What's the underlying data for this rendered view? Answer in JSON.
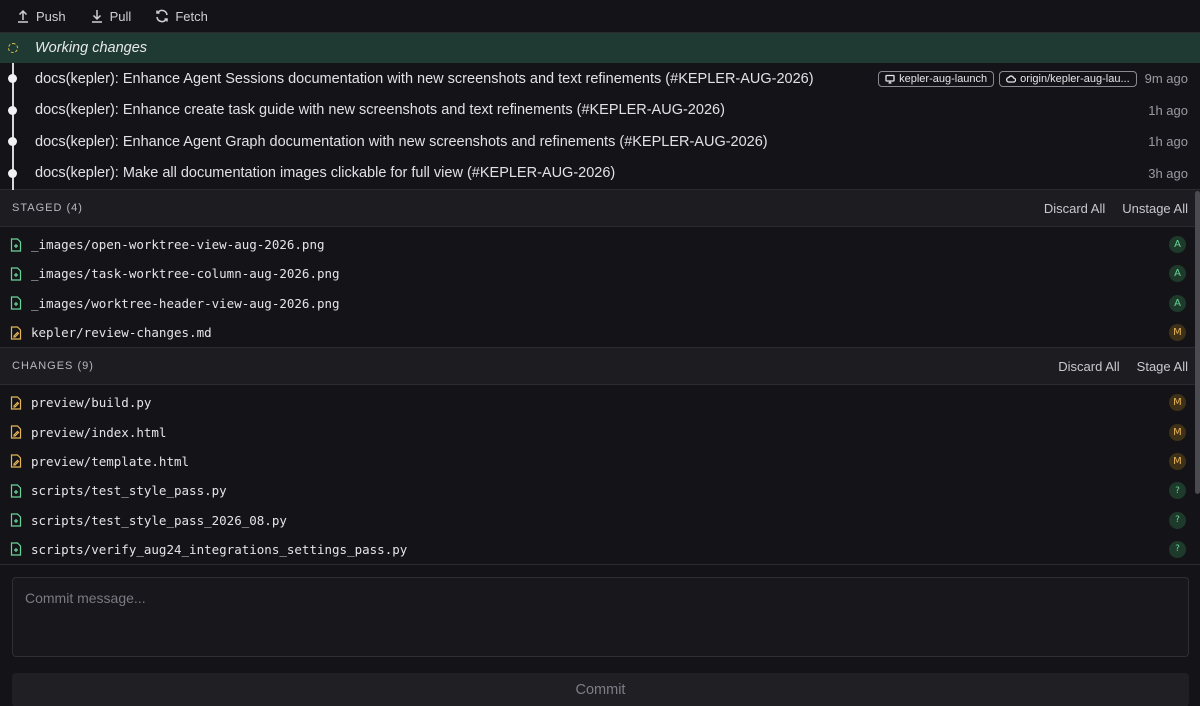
{
  "toolbar": {
    "push_label": "Push",
    "pull_label": "Pull",
    "fetch_label": "Fetch"
  },
  "graph": {
    "working_label": "Working changes",
    "commits": [
      {
        "message": "docs(kepler): Enhance Agent Sessions documentation with new screenshots and text refinements (#KEPLER-AUG-2026)",
        "local_branch": "kepler-aug-launch",
        "remote_branch": "origin/kepler-aug-lau...",
        "time": "9m ago"
      },
      {
        "message": "docs(kepler): Enhance create task guide with new screenshots and text refinements (#KEPLER-AUG-2026)",
        "time": "1h ago"
      },
      {
        "message": "docs(kepler): Enhance Agent Graph documentation with new screenshots and refinements (#KEPLER-AUG-2026)",
        "time": "1h ago"
      },
      {
        "message": "docs(kepler): Make all documentation images clickable for full view (#KEPLER-AUG-2026)",
        "time": "3h ago"
      }
    ]
  },
  "staged": {
    "title": "STAGED (4)",
    "discard_label": "Discard All",
    "unstage_label": "Unstage All",
    "files": [
      {
        "name": "_images/open-worktree-view-aug-2026.png",
        "status": "A"
      },
      {
        "name": "_images/task-worktree-column-aug-2026.png",
        "status": "A"
      },
      {
        "name": "_images/worktree-header-view-aug-2026.png",
        "status": "A"
      },
      {
        "name": "kepler/review-changes.md",
        "status": "M"
      }
    ]
  },
  "changes": {
    "title": "CHANGES (9)",
    "discard_label": "Discard All",
    "stage_label": "Stage All",
    "files": [
      {
        "name": "preview/build.py",
        "status": "M"
      },
      {
        "name": "preview/index.html",
        "status": "M"
      },
      {
        "name": "preview/template.html",
        "status": "M"
      },
      {
        "name": "scripts/test_style_pass.py",
        "status": "?"
      },
      {
        "name": "scripts/test_style_pass_2026_08.py",
        "status": "?"
      },
      {
        "name": "scripts/verify_aug24_integrations_settings_pass.py",
        "status": "?"
      }
    ]
  },
  "commit": {
    "placeholder": "Commit message...",
    "button_label": "Commit"
  },
  "colors": {
    "added": "#6bd49a",
    "modified": "#e6b45a",
    "working_bg": "#1f3a33"
  }
}
